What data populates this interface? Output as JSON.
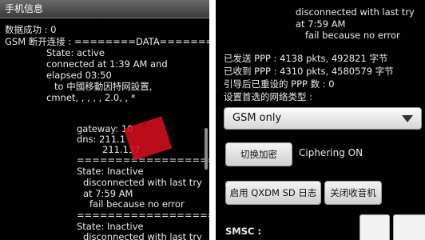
{
  "left": {
    "title": "手机信息",
    "lines": [
      "数据成功 : 0",
      "GSM 断开连接 : ========DATA=======",
      "State: active",
      "connected at 1:39 AM and",
      "elapsed 03:50",
      "to 中國移動因特网設置,",
      "cmnet, , , , , 2.0, , *",
      "gateway: 10",
      "dns: 211.1",
      "211.137",
      "======================",
      "State: Inactive",
      "disconnected with last try",
      "at 7:59 AM",
      "fail because no error",
      "======================",
      "State: Inactive",
      "disconnected with last try"
    ]
  },
  "right": {
    "lines": [
      "disconnected with last try",
      "at 7:59 AM",
      "fail because no error",
      "已发送 PPP : 4138 pkts, 492821 字节",
      "已收到 PPP : 4310 pkts, 4580579 字节",
      "引导后已重设的 PPP 数 : 0",
      "设置首选的网络类型 :"
    ],
    "network_type_value": "GSM only",
    "cipher_button_label": "切换加密",
    "cipher_status": "Ciphering ON",
    "qxdm_button_label": "启用 QXDM SD 日志",
    "radio_off_button_label": "关闭收音机",
    "smsc_label": "SMSC :"
  }
}
